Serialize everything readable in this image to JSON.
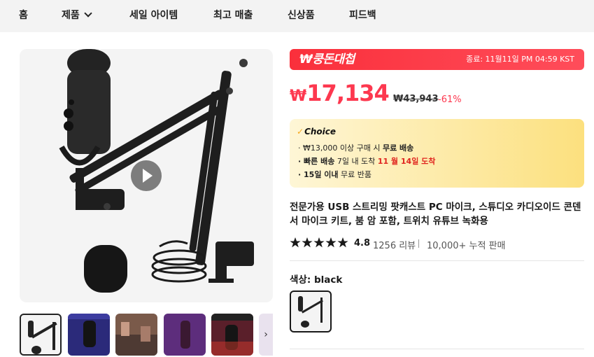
{
  "nav": {
    "items": [
      "홈",
      "제품",
      "세일 아이템",
      "최고 매출",
      "신상품",
      "피드백"
    ]
  },
  "deal": {
    "name": "₩쿵돈대첩",
    "timer": "종료: 11월11일 PM 04:59 KST"
  },
  "price": {
    "currency": "₩",
    "amount": "17,134",
    "original": "₩43,943",
    "discount": "-61%"
  },
  "choice": {
    "label": "Choice",
    "line1_prefix": "· ₩13,000 이상 구매 시 ",
    "line1_bold": "무료 배송",
    "line2_bold": "· 빠른 배송",
    "line2_mid": " 7일 내 도착 ",
    "line2_red": "11 월 14일 도착",
    "line3_bold": "· 15일 이내",
    "line3_rest": " 무료 반품"
  },
  "product": {
    "title": "전문가용 USB 스트리밍 팟캐스트 PC 마이크, 스튜디오 카디오이드 콘덴서 마이크 키트, 붐 암 포함, 트위치 유튜브 녹화용"
  },
  "rating": {
    "value": "4.8",
    "stars": 4.8,
    "reviews": "1256 리뷰",
    "sold": "10,000+ 누적 판매"
  },
  "variant": {
    "label": "색상: black"
  },
  "colors": {
    "accent_red": "#fd384f",
    "choice_gold": "#f7a81b"
  },
  "icons": {
    "play": "play-icon",
    "chevron": "chevron-down-icon",
    "next": "chevron-right-icon"
  }
}
